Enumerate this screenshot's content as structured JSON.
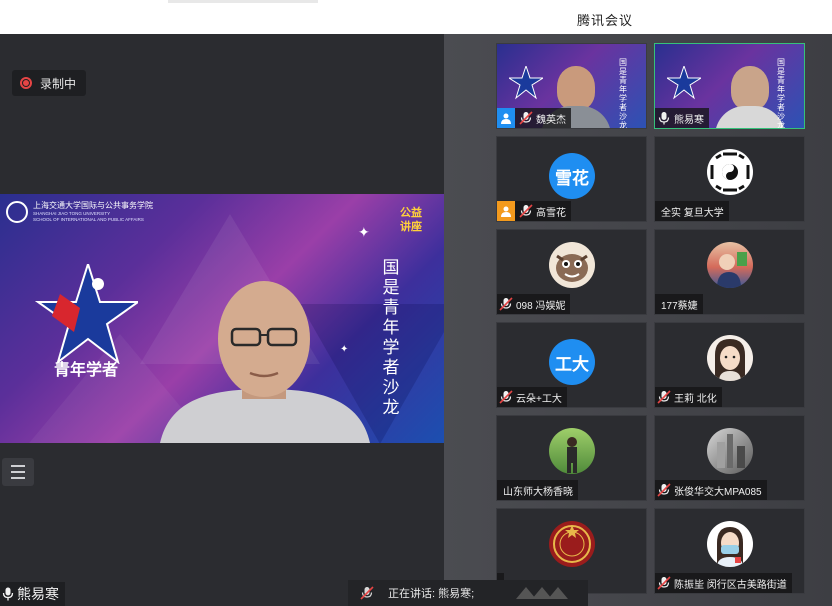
{
  "window": {
    "title": "腾讯会议"
  },
  "recording": {
    "label": "录制中"
  },
  "main_video": {
    "university_cn": "上海交通大学国际与公共事务学院",
    "university_en_1": "SHANGHAI JIAO TONG UNIVERSITY",
    "university_en_2": "SCHOOL OF INTERNATIONAL AND PUBLIC AFFAIRS",
    "lecture_tag": "公益讲座",
    "salon_title": "国是青年学者沙龙",
    "scholar_label": "青年学者",
    "speaker_name": "熊易寒"
  },
  "participants": [
    {
      "name": "魏英杰",
      "kind": "video",
      "host": "blue",
      "mic": "muted"
    },
    {
      "name": "熊易寒",
      "kind": "video",
      "host": "",
      "mic": "on",
      "active": true
    },
    {
      "name": "高雪花",
      "kind": "initials",
      "initials": "雪花",
      "host": "orange",
      "mic": "muted"
    },
    {
      "name": "全实 复旦大学",
      "kind": "avatar",
      "avatar": "bagua-icon",
      "mic": "none"
    },
    {
      "name": "098 冯娱妮",
      "kind": "avatar",
      "avatar": "cartoon-avatar",
      "mic": "muted"
    },
    {
      "name": "177蔡婕",
      "kind": "avatar",
      "avatar": "photo-avatar",
      "mic": "none"
    },
    {
      "name": "云朵+工大",
      "kind": "initials",
      "initials": "工大",
      "host": "",
      "mic": "muted"
    },
    {
      "name": "王莉 北化",
      "kind": "avatar",
      "avatar": "girl-avatar",
      "mic": "muted"
    },
    {
      "name": "山东师大杨香晓",
      "kind": "avatar",
      "avatar": "outdoor-avatar",
      "mic": "none"
    },
    {
      "name": "张俊华交大MPA085",
      "kind": "avatar",
      "avatar": "gray-avatar",
      "mic": "muted"
    },
    {
      "name": "",
      "kind": "avatar",
      "avatar": "red-seal-avatar",
      "mic": "none"
    },
    {
      "name": "陈振坒 闵行区古美路街道",
      "kind": "avatar",
      "avatar": "nurse-avatar",
      "mic": "muted"
    }
  ],
  "speaking": {
    "text": "正在讲话: 熊易寒;"
  },
  "colors": {
    "accent": "#1f8ef1",
    "recording": "#e64545",
    "active_border": "#35c27a",
    "host_orange": "#f39a1d"
  }
}
